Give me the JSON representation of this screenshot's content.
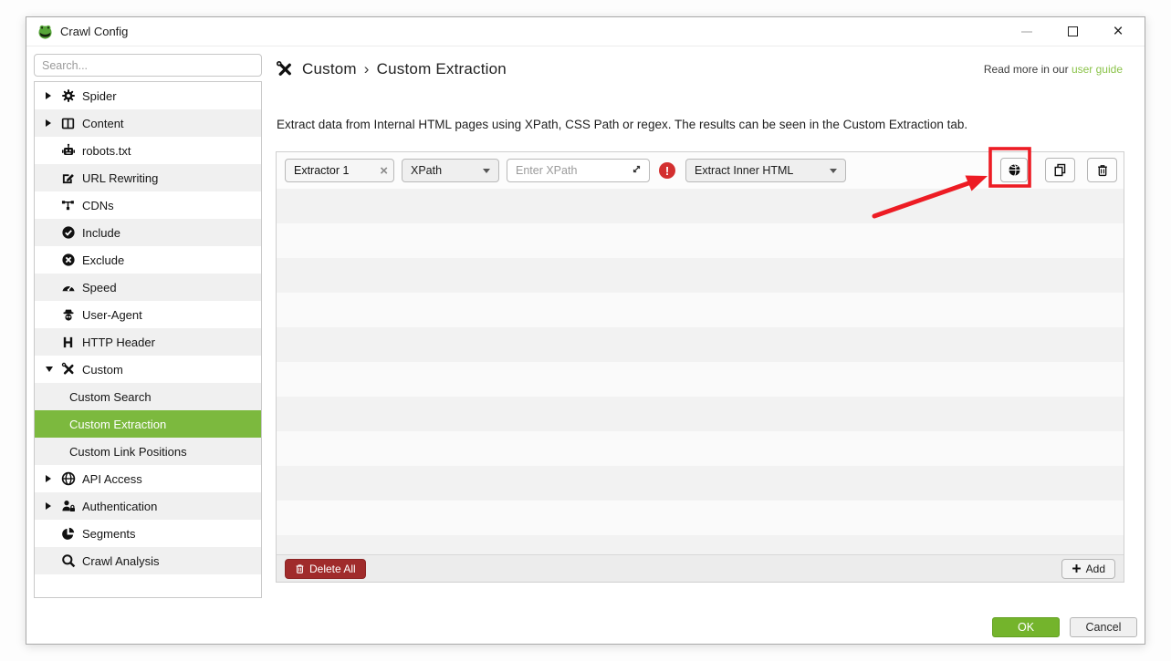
{
  "titlebar": {
    "title": "Crawl Config"
  },
  "sidebar": {
    "search_placeholder": "Search...",
    "items": [
      {
        "label": "Spider",
        "icon": "gear-icon",
        "expander": "collapsed"
      },
      {
        "label": "Content",
        "icon": "columns-icon",
        "expander": "collapsed"
      },
      {
        "label": "robots.txt",
        "icon": "robot-icon"
      },
      {
        "label": "URL Rewriting",
        "icon": "edit-icon"
      },
      {
        "label": "CDNs",
        "icon": "network-icon"
      },
      {
        "label": "Include",
        "icon": "check-circle-icon"
      },
      {
        "label": "Exclude",
        "icon": "cross-circle-icon"
      },
      {
        "label": "Speed",
        "icon": "speedometer-icon"
      },
      {
        "label": "User-Agent",
        "icon": "spy-icon"
      },
      {
        "label": "HTTP Header",
        "icon": "h-icon"
      },
      {
        "label": "Custom",
        "icon": "tools-icon",
        "expander": "expanded"
      },
      {
        "label": "Custom Search",
        "child": true
      },
      {
        "label": "Custom Extraction",
        "child": true,
        "selected": true
      },
      {
        "label": "Custom Link Positions",
        "child": true
      },
      {
        "label": "API Access",
        "icon": "globe-icon",
        "expander": "collapsed"
      },
      {
        "label": "Authentication",
        "icon": "user-lock-icon",
        "expander": "collapsed"
      },
      {
        "label": "Segments",
        "icon": "pie-icon"
      },
      {
        "label": "Crawl Analysis",
        "icon": "magnifier-icon"
      }
    ]
  },
  "main": {
    "breadcrumb": {
      "parent": "Custom",
      "separator": "›",
      "current": "Custom Extraction"
    },
    "read_more": {
      "prefix": "Read more in our",
      "link_label": "user guide"
    },
    "description": "Extract data from Internal HTML pages using XPath, CSS Path or regex. The results can be seen in the Custom Extraction tab.",
    "extractor": {
      "name_value": "Extractor 1",
      "type_selected": "XPath",
      "xpath_placeholder": "Enter XPath",
      "output_selected": "Extract Inner HTML"
    },
    "bottom_toolbar": {
      "delete_all_label": "Delete All",
      "add_label": "Add"
    }
  },
  "footer": {
    "ok_label": "OK",
    "cancel_label": "Cancel"
  },
  "colors": {
    "accent_green": "#7cb93e",
    "link_green": "#8bc34a",
    "delete_red": "#a02b2b",
    "error_red": "#d32f2f",
    "annotation_red": "#ed1c24"
  }
}
